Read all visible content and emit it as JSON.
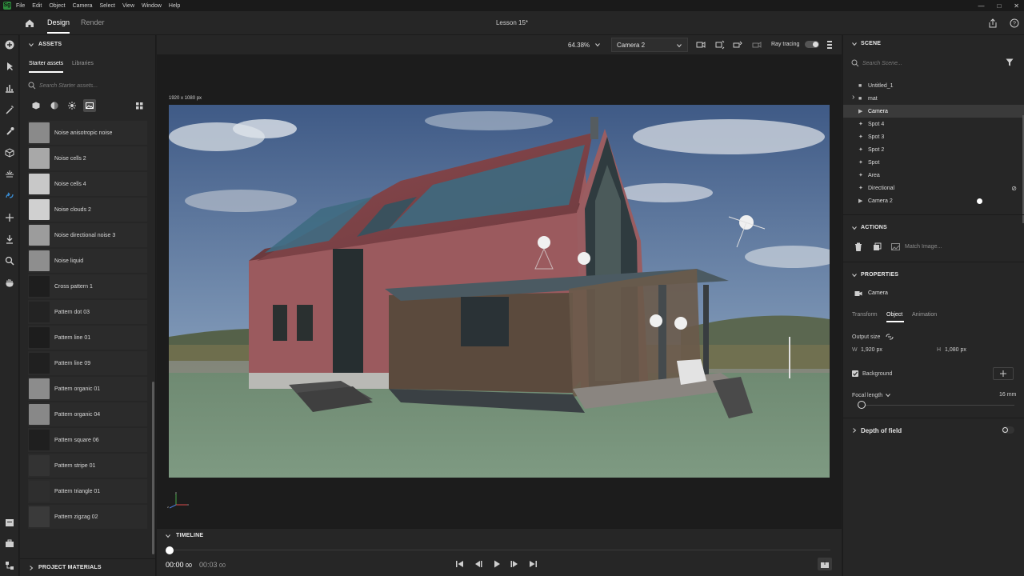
{
  "menubar": {
    "logo": "Sg",
    "items": [
      "File",
      "Edit",
      "Object",
      "Camera",
      "Select",
      "View",
      "Window",
      "Help"
    ]
  },
  "header": {
    "tabs": [
      "Design",
      "Render"
    ],
    "active_tab": "Design",
    "doc_title": "Lesson 15*"
  },
  "assets": {
    "title": "ASSETS",
    "subtabs": [
      "Starter assets",
      "Libraries"
    ],
    "search_placeholder": "Search Starter assets...",
    "items": [
      {
        "label": "Noise anisotropic noise",
        "tone": "#8a8a8a"
      },
      {
        "label": "Noise cells 2",
        "tone": "#a8a8a8"
      },
      {
        "label": "Noise cells 4",
        "tone": "#c8c8c8"
      },
      {
        "label": "Noise clouds 2",
        "tone": "#d0d0d0"
      },
      {
        "label": "Noise directional noise 3",
        "tone": "#9c9c9c"
      },
      {
        "label": "Noise liquid",
        "tone": "#8e8e8e"
      },
      {
        "label": "Cross pattern 1",
        "tone": "#1e1e1e"
      },
      {
        "label": "Pattern dot 03",
        "tone": "#232323"
      },
      {
        "label": "Pattern line 01",
        "tone": "#1d1d1d"
      },
      {
        "label": "Pattern line 09",
        "tone": "#202020"
      },
      {
        "label": "Pattern organic 01",
        "tone": "#8c8c8c"
      },
      {
        "label": "Pattern organic 04",
        "tone": "#888888"
      },
      {
        "label": "Pattern square 06",
        "tone": "#1f1f1f"
      },
      {
        "label": "Pattern stripe 01",
        "tone": "#333333"
      },
      {
        "label": "Pattern triangle 01",
        "tone": "#2e2e2e"
      },
      {
        "label": "Pattern zigzag 02",
        "tone": "#3a3a3a"
      }
    ],
    "footer": "PROJECT MATERIALS"
  },
  "viewport": {
    "zoom": "64.38%",
    "camera": "Camera 2",
    "ray_tracing_label": "Ray tracing",
    "resolution_label": "1920 x 1080 px"
  },
  "timeline": {
    "title": "TIMELINE",
    "current_time": "00:00",
    "current_frames": "00",
    "total_time": "00:03",
    "total_frames": "00"
  },
  "scene": {
    "title": "SCENE",
    "search_placeholder": "Search Scene...",
    "items": [
      {
        "label": "Untitled_1",
        "icon": "folder",
        "selected": false
      },
      {
        "label": "mat",
        "icon": "folder",
        "selected": false
      },
      {
        "label": "Camera",
        "icon": "camera",
        "selected": true
      },
      {
        "label": "Spot 4",
        "icon": "light",
        "selected": false
      },
      {
        "label": "Spot 3",
        "icon": "light",
        "selected": false
      },
      {
        "label": "Spot 2",
        "icon": "light",
        "selected": false
      },
      {
        "label": "Spot",
        "icon": "light",
        "selected": false
      },
      {
        "label": "Area",
        "icon": "light",
        "selected": false
      },
      {
        "label": "Directional",
        "icon": "light",
        "selected": false
      },
      {
        "label": "Camera 2",
        "icon": "camera",
        "selected": false
      }
    ]
  },
  "actions": {
    "title": "ACTIONS",
    "match_image": "Match Image..."
  },
  "properties": {
    "title": "PROPERTIES",
    "object_name": "Camera",
    "tabs": [
      "Transform",
      "Object",
      "Animation"
    ],
    "active_tab": "Object",
    "output_size_label": "Output size",
    "w_label": "W",
    "w_value": "1,920 px",
    "h_label": "H",
    "h_value": "1,080 px",
    "background_label": "Background",
    "focal_length_label": "Focal length",
    "focal_length_value": "16 mm",
    "depth_of_field_label": "Depth of field"
  }
}
